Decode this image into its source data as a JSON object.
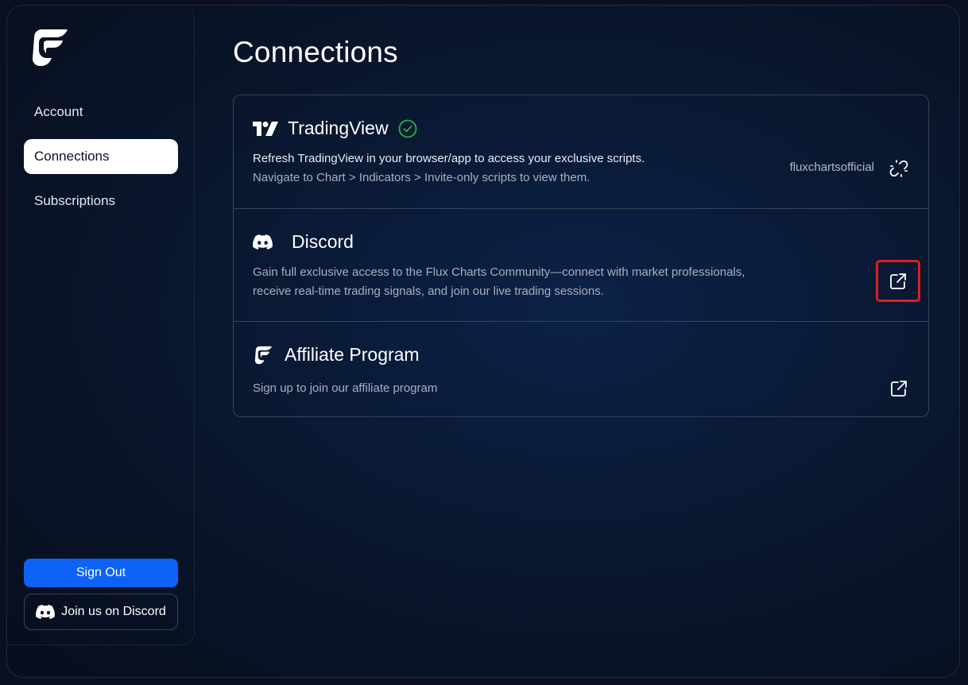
{
  "sidebar": {
    "logo": "flux-charts-logo",
    "items": [
      {
        "label": "Account",
        "active": false
      },
      {
        "label": "Connections",
        "active": true
      },
      {
        "label": "Subscriptions",
        "active": false
      }
    ],
    "sign_out_label": "Sign Out",
    "join_discord_label": "Join us on Discord"
  },
  "main": {
    "title": "Connections",
    "connections": [
      {
        "name": "TradingView",
        "icon": "tradingview-icon",
        "status": "connected",
        "description_line1": "Refresh TradingView in your browser/app to access your exclusive scripts.",
        "description_line2": "Navigate to Chart > Indicators > Invite-only scripts to view them.",
        "username": "fluxchartsofficial",
        "action_icon": "unlink-icon"
      },
      {
        "name": "Discord",
        "icon": "discord-icon",
        "description_line1": "Gain full exclusive access to the Flux Charts Community—connect with market professionals,",
        "description_line2": "receive real-time trading signals, and join our live trading sessions.",
        "action_icon": "external-link-icon"
      },
      {
        "name": "Affiliate Program",
        "icon": "flux-charts-icon",
        "description_line1": "Sign up to join our affiliate program",
        "action_icon": "external-link-icon"
      }
    ]
  },
  "colors": {
    "accent_blue": "#0d63f6",
    "connected_green": "#22b34a",
    "highlight_red": "#e01e1e",
    "background": "#0a1a36"
  }
}
